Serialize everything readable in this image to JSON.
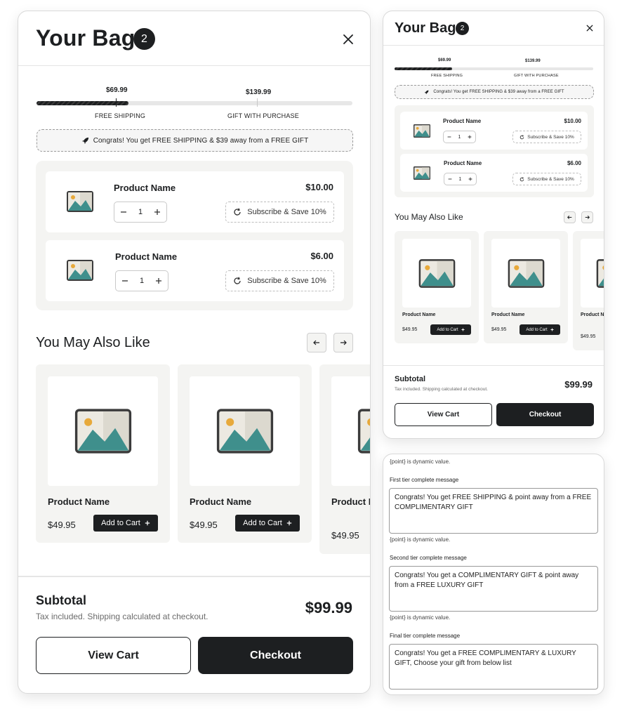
{
  "bag": {
    "title": "Your Bag",
    "count": "2"
  },
  "progress": {
    "tier1_amount": "$69.99",
    "tier1_label": "FREE SHIPPING",
    "tier2_amount": "$139.99",
    "tier2_label": "GIFT WITH PURCHASE",
    "fill_fraction": 0.29
  },
  "congrats_message": "Congrats! You get FREE SHIPPING & $39 away from a FREE GIFT",
  "cart_items": [
    {
      "name": "Product Name",
      "price": "$10.00",
      "quantity": "1",
      "subscribe_label": "Subscribe & Save 10%"
    },
    {
      "name": "Product Name",
      "price": "$6.00",
      "quantity": "1",
      "subscribe_label": "Subscribe & Save 10%"
    }
  ],
  "recommendations": {
    "title": "You May Also Like",
    "items": [
      {
        "name": "Product Name",
        "price": "$49.95",
        "button_label": "Add to Cart"
      },
      {
        "name": "Product Name",
        "price": "$49.95",
        "button_label": "Add to Cart"
      },
      {
        "name": "Product N",
        "price": "$49.95"
      }
    ]
  },
  "summary": {
    "subtotal_label": "Subtotal",
    "note": "Tax included. Shipping calculated at checkout.",
    "subtotal_value": "$99.99",
    "view_cart_label": "View Cart",
    "checkout_label": "Checkout"
  },
  "settings": {
    "dynamic_hint": "{point} is dynamic value.",
    "tiers": [
      {
        "label": "First tier complete message",
        "message": "Congrats! You get FREE SHIPPING & point away from a FREE COMPLIMENTARY GIFT"
      },
      {
        "label": "Second tier complete message",
        "message": "Congrats! You get a COMPLIMENTARY GIFT & point away from a FREE LUXURY GIFT"
      },
      {
        "label": "Final tier complete message",
        "message": "Congrats! You get a FREE COMPLIMENTARY & LUXURY GIFT, Choose your gift from below list"
      }
    ]
  },
  "icons": {
    "close": "close-icon",
    "minus": "minus-icon",
    "plus": "plus-icon",
    "refresh": "refresh-icon",
    "rocket": "rocket-icon",
    "arrow_left": "arrow-left-icon",
    "arrow_right": "arrow-right-icon",
    "image_placeholder": "image-placeholder-icon"
  },
  "colors": {
    "primary": "#1d1f21",
    "panel_bg": "#f4f4f2",
    "image_teal": "#3f8f8c",
    "image_sun": "#e7a93b"
  }
}
